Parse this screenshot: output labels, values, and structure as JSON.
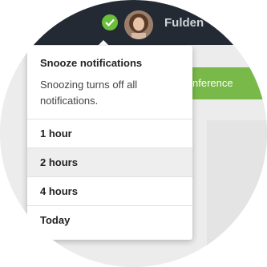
{
  "header": {
    "username": "Fulden",
    "status_color": "#6abf3b",
    "avatar_icon": "user-avatar"
  },
  "toolbar": {
    "conference_label": "nference"
  },
  "snooze_menu": {
    "title": "Snooze notifications",
    "description": "Snoozing turns off all notifications.",
    "options": [
      {
        "label": "1 hour"
      },
      {
        "label": "2 hours"
      },
      {
        "label": "4 hours"
      },
      {
        "label": "Today"
      }
    ]
  },
  "colors": {
    "topbar": "#232a33",
    "accent_green": "#79b94a"
  }
}
